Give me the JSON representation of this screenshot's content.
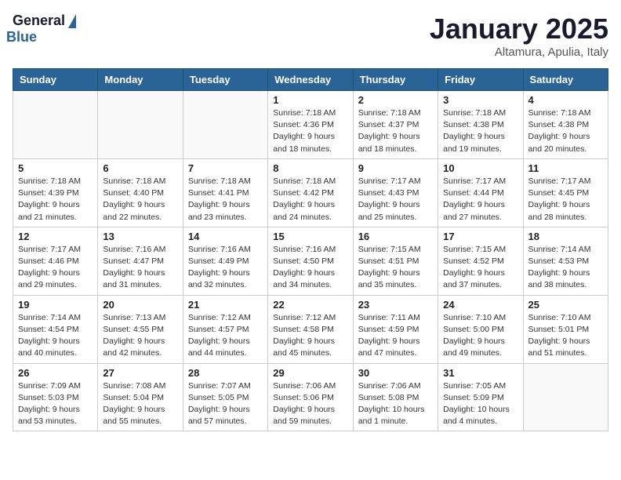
{
  "logo": {
    "general": "General",
    "blue": "Blue"
  },
  "header": {
    "month": "January 2025",
    "location": "Altamura, Apulia, Italy"
  },
  "weekdays": [
    "Sunday",
    "Monday",
    "Tuesday",
    "Wednesday",
    "Thursday",
    "Friday",
    "Saturday"
  ],
  "weeks": [
    [
      {
        "day": "",
        "info": ""
      },
      {
        "day": "",
        "info": ""
      },
      {
        "day": "",
        "info": ""
      },
      {
        "day": "1",
        "info": "Sunrise: 7:18 AM\nSunset: 4:36 PM\nDaylight: 9 hours\nand 18 minutes."
      },
      {
        "day": "2",
        "info": "Sunrise: 7:18 AM\nSunset: 4:37 PM\nDaylight: 9 hours\nand 18 minutes."
      },
      {
        "day": "3",
        "info": "Sunrise: 7:18 AM\nSunset: 4:38 PM\nDaylight: 9 hours\nand 19 minutes."
      },
      {
        "day": "4",
        "info": "Sunrise: 7:18 AM\nSunset: 4:38 PM\nDaylight: 9 hours\nand 20 minutes."
      }
    ],
    [
      {
        "day": "5",
        "info": "Sunrise: 7:18 AM\nSunset: 4:39 PM\nDaylight: 9 hours\nand 21 minutes."
      },
      {
        "day": "6",
        "info": "Sunrise: 7:18 AM\nSunset: 4:40 PM\nDaylight: 9 hours\nand 22 minutes."
      },
      {
        "day": "7",
        "info": "Sunrise: 7:18 AM\nSunset: 4:41 PM\nDaylight: 9 hours\nand 23 minutes."
      },
      {
        "day": "8",
        "info": "Sunrise: 7:18 AM\nSunset: 4:42 PM\nDaylight: 9 hours\nand 24 minutes."
      },
      {
        "day": "9",
        "info": "Sunrise: 7:17 AM\nSunset: 4:43 PM\nDaylight: 9 hours\nand 25 minutes."
      },
      {
        "day": "10",
        "info": "Sunrise: 7:17 AM\nSunset: 4:44 PM\nDaylight: 9 hours\nand 27 minutes."
      },
      {
        "day": "11",
        "info": "Sunrise: 7:17 AM\nSunset: 4:45 PM\nDaylight: 9 hours\nand 28 minutes."
      }
    ],
    [
      {
        "day": "12",
        "info": "Sunrise: 7:17 AM\nSunset: 4:46 PM\nDaylight: 9 hours\nand 29 minutes."
      },
      {
        "day": "13",
        "info": "Sunrise: 7:16 AM\nSunset: 4:47 PM\nDaylight: 9 hours\nand 31 minutes."
      },
      {
        "day": "14",
        "info": "Sunrise: 7:16 AM\nSunset: 4:49 PM\nDaylight: 9 hours\nand 32 minutes."
      },
      {
        "day": "15",
        "info": "Sunrise: 7:16 AM\nSunset: 4:50 PM\nDaylight: 9 hours\nand 34 minutes."
      },
      {
        "day": "16",
        "info": "Sunrise: 7:15 AM\nSunset: 4:51 PM\nDaylight: 9 hours\nand 35 minutes."
      },
      {
        "day": "17",
        "info": "Sunrise: 7:15 AM\nSunset: 4:52 PM\nDaylight: 9 hours\nand 37 minutes."
      },
      {
        "day": "18",
        "info": "Sunrise: 7:14 AM\nSunset: 4:53 PM\nDaylight: 9 hours\nand 38 minutes."
      }
    ],
    [
      {
        "day": "19",
        "info": "Sunrise: 7:14 AM\nSunset: 4:54 PM\nDaylight: 9 hours\nand 40 minutes."
      },
      {
        "day": "20",
        "info": "Sunrise: 7:13 AM\nSunset: 4:55 PM\nDaylight: 9 hours\nand 42 minutes."
      },
      {
        "day": "21",
        "info": "Sunrise: 7:12 AM\nSunset: 4:57 PM\nDaylight: 9 hours\nand 44 minutes."
      },
      {
        "day": "22",
        "info": "Sunrise: 7:12 AM\nSunset: 4:58 PM\nDaylight: 9 hours\nand 45 minutes."
      },
      {
        "day": "23",
        "info": "Sunrise: 7:11 AM\nSunset: 4:59 PM\nDaylight: 9 hours\nand 47 minutes."
      },
      {
        "day": "24",
        "info": "Sunrise: 7:10 AM\nSunset: 5:00 PM\nDaylight: 9 hours\nand 49 minutes."
      },
      {
        "day": "25",
        "info": "Sunrise: 7:10 AM\nSunset: 5:01 PM\nDaylight: 9 hours\nand 51 minutes."
      }
    ],
    [
      {
        "day": "26",
        "info": "Sunrise: 7:09 AM\nSunset: 5:03 PM\nDaylight: 9 hours\nand 53 minutes."
      },
      {
        "day": "27",
        "info": "Sunrise: 7:08 AM\nSunset: 5:04 PM\nDaylight: 9 hours\nand 55 minutes."
      },
      {
        "day": "28",
        "info": "Sunrise: 7:07 AM\nSunset: 5:05 PM\nDaylight: 9 hours\nand 57 minutes."
      },
      {
        "day": "29",
        "info": "Sunrise: 7:06 AM\nSunset: 5:06 PM\nDaylight: 9 hours\nand 59 minutes."
      },
      {
        "day": "30",
        "info": "Sunrise: 7:06 AM\nSunset: 5:08 PM\nDaylight: 10 hours\nand 1 minute."
      },
      {
        "day": "31",
        "info": "Sunrise: 7:05 AM\nSunset: 5:09 PM\nDaylight: 10 hours\nand 4 minutes."
      },
      {
        "day": "",
        "info": ""
      }
    ]
  ]
}
